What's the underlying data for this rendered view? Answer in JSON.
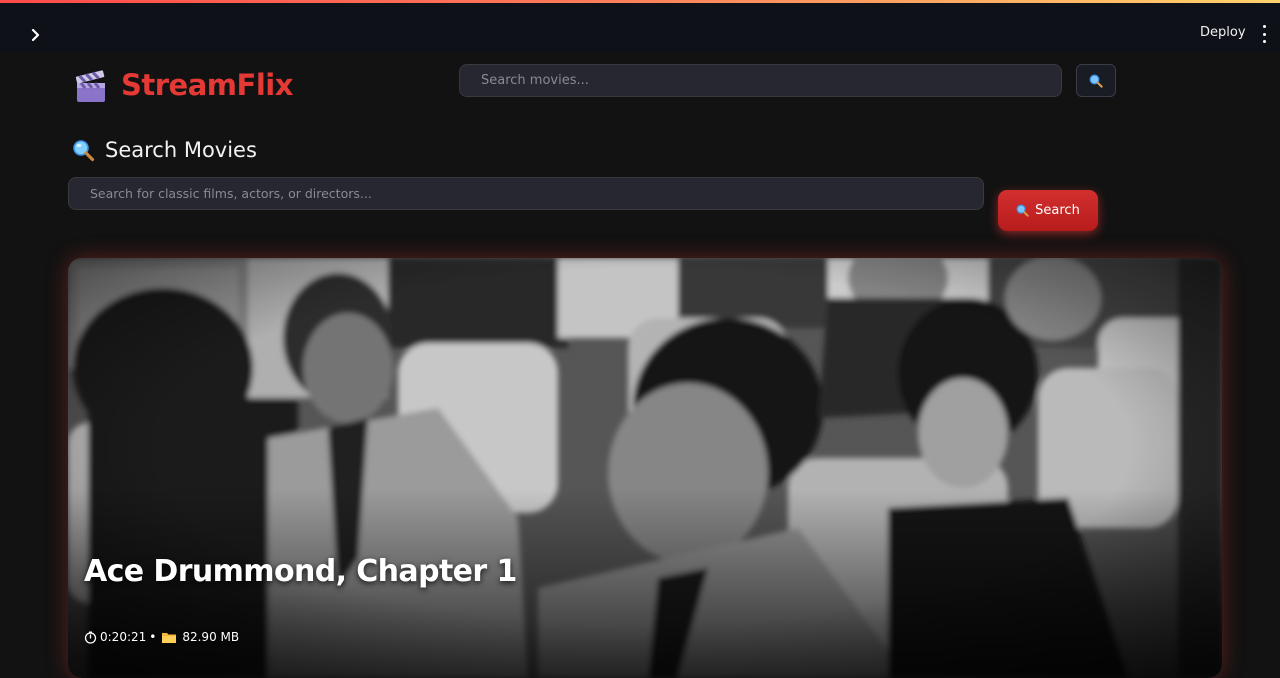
{
  "app": {
    "logo_text": "StreamFlix",
    "logo_icon": "clapperboard-icon"
  },
  "topbar": {
    "deploy_label": "Deploy",
    "sidebar_toggle_icon": "chevron-right-icon",
    "menu_icon": "kebab-menu-icon"
  },
  "header_search": {
    "placeholder": "Search movies...",
    "button_icon": "magnifier-icon"
  },
  "search_section": {
    "title": "Search Movies",
    "title_icon": "magnifier-icon",
    "placeholder": "Search for classic films, actors, or directors...",
    "button_label": "Search",
    "button_icon": "magnifier-icon"
  },
  "featured": {
    "title": "Ace Drummond, Chapter 1",
    "duration": "0:20:21",
    "separator": "•",
    "size": "82.90 MB",
    "duration_icon": "stopwatch-icon",
    "size_icon": "folder-icon"
  },
  "colors": {
    "accent": "#e53935",
    "background": "#121212",
    "topbar": "#0e1117",
    "input": "#262730"
  }
}
